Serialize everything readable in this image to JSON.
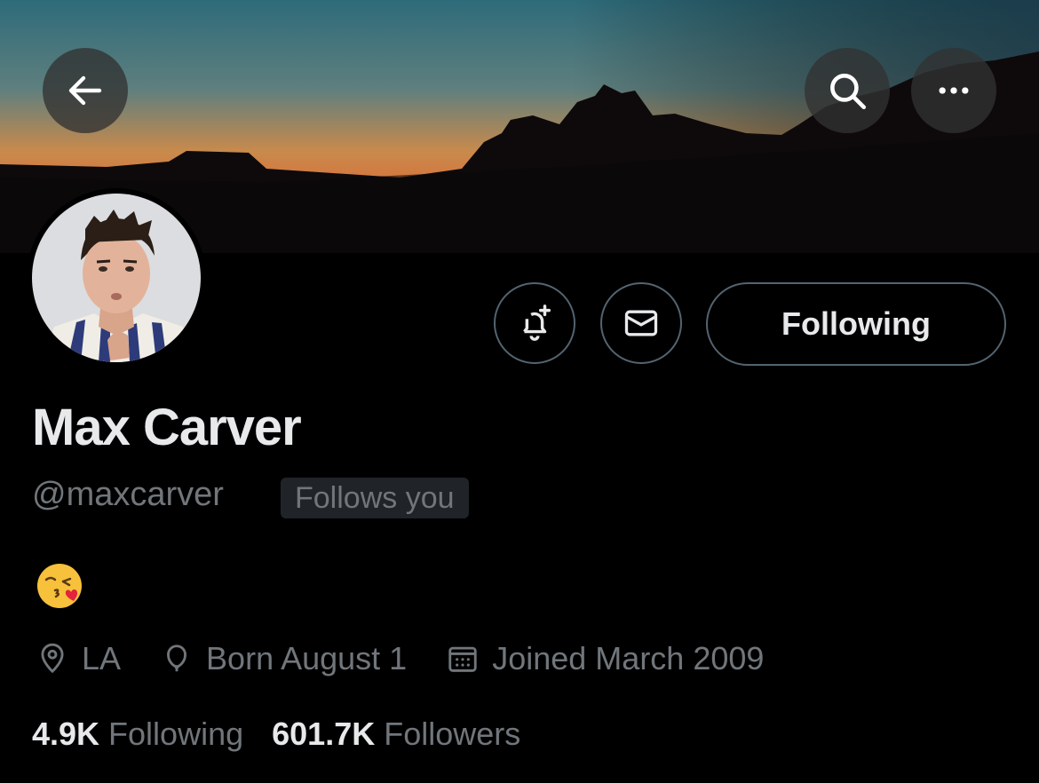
{
  "profile": {
    "name": "Max Carver",
    "handle": "@maxcarver",
    "follows_you_badge": "Follows you",
    "bio_emoji": "face-blowing-a-kiss",
    "location": "LA",
    "birthday": "Born August 1",
    "joined": "Joined March 2009"
  },
  "actions": {
    "follow_label": "Following"
  },
  "stats": {
    "following_count": "4.9K",
    "following_label": "Following",
    "followers_count": "601.7K",
    "followers_label": "Followers"
  },
  "icons": {
    "back": "arrow-left-icon",
    "search": "search-icon",
    "more": "more-icon",
    "notify": "bell-plus-icon",
    "message": "envelope-icon",
    "location": "location-pin-icon",
    "birthday": "balloon-icon",
    "joined": "calendar-icon"
  },
  "colors": {
    "background": "#000000",
    "primary_text": "#e7e9ea",
    "secondary_text": "#71767b",
    "border": "#536471",
    "badge_bg": "#202327"
  }
}
